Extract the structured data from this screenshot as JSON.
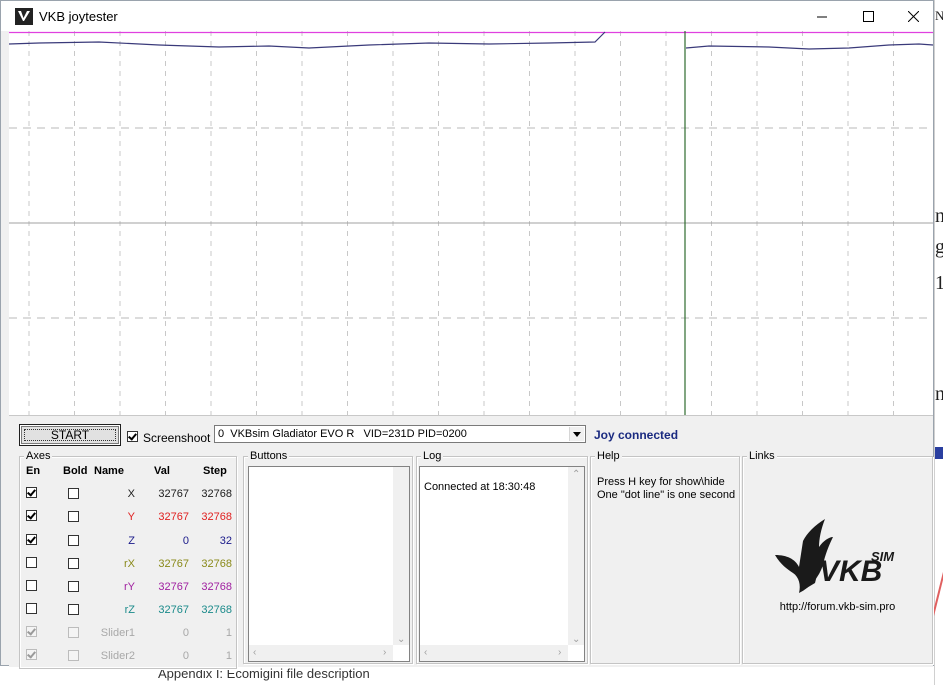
{
  "window": {
    "title": "VKB joytester",
    "controls": {
      "minimize": "minimize-icon",
      "maximize": "maximize-icon",
      "close": "close-icon"
    }
  },
  "graph": {
    "colors": {
      "top_line": "#e040e0",
      "trace": "#3a3a7a",
      "cursor": "#2e6b2e",
      "grid": "#c8c8c8",
      "midline": "#a0a0a0"
    }
  },
  "toolbar": {
    "start_label": "START",
    "screenshoot_label": "Screenshoot",
    "screenshoot_checked": true,
    "device_value": "0  VKBsim Gladiator EVO R   VID=231D PID=0200",
    "status": "Joy connected"
  },
  "axes": {
    "title": "Axes",
    "headers": {
      "en": "En",
      "bold": "Bold",
      "name": "Name",
      "val": "Val",
      "step": "Step"
    },
    "rows": [
      {
        "en": true,
        "bold": false,
        "name": "X",
        "val": "32767",
        "step": "32768",
        "color": "#202020",
        "disabled": false
      },
      {
        "en": true,
        "bold": false,
        "name": "Y",
        "val": "32767",
        "step": "32768",
        "color": "#e02020",
        "disabled": false
      },
      {
        "en": true,
        "bold": false,
        "name": "Z",
        "val": "0",
        "step": "32",
        "color": "#1a1a8a",
        "disabled": false
      },
      {
        "en": false,
        "bold": false,
        "name": "rX",
        "val": "32767",
        "step": "32768",
        "color": "#8a8a1a",
        "disabled": false
      },
      {
        "en": false,
        "bold": false,
        "name": "rY",
        "val": "32767",
        "step": "32768",
        "color": "#a020a0",
        "disabled": false
      },
      {
        "en": false,
        "bold": false,
        "name": "rZ",
        "val": "32767",
        "step": "32768",
        "color": "#1a8a8a",
        "disabled": false
      },
      {
        "en": true,
        "bold": false,
        "name": "Slider1",
        "val": "0",
        "step": "1",
        "color": "#a8a8a8",
        "disabled": true
      },
      {
        "en": true,
        "bold": false,
        "name": "Slider2",
        "val": "0",
        "step": "1",
        "color": "#a8a8a8",
        "disabled": true
      }
    ]
  },
  "buttons_group": {
    "title": "Buttons"
  },
  "log": {
    "title": "Log",
    "entries": [
      "Connected at 18:30:48"
    ]
  },
  "help": {
    "title": "Help",
    "line1": "Press H key for show\\hide",
    "line2": "One \"dot line\" is one second"
  },
  "links": {
    "title": "Links",
    "logo_text": "VKB",
    "logo_sup": "SIM",
    "url": "http://forum.vkb-sim.pro"
  },
  "background": {
    "footer_fragment": "Appendix I: Ecomigini file description",
    "right_fragments": [
      "n",
      "g",
      "1",
      "n"
    ]
  }
}
